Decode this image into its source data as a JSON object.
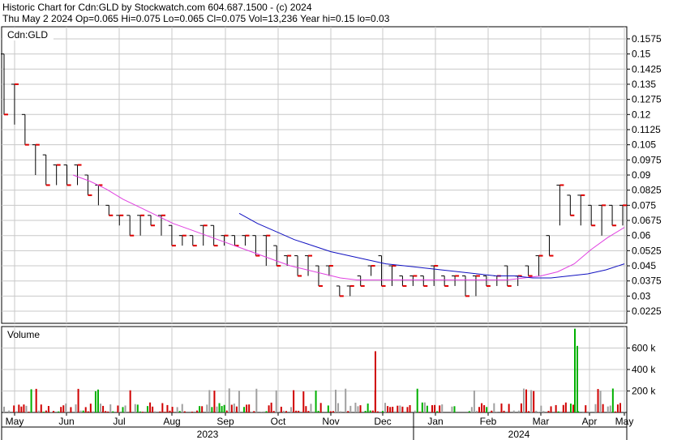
{
  "header": {
    "line1": "Historic Chart for Cdn:GLD by Stockwatch.com 604.687.1500 - (c) 2024",
    "line2": "Thu May  2 2024  Op=0.065  Hi=0.075  Lo=0.065  Cl=0.075  Vol=13,236  Year hi=0.15  lo=0.03"
  },
  "price_panel": {
    "label": "Cdn:GLD"
  },
  "volume_panel": {
    "label": "Volume"
  },
  "colors": {
    "grid": "#c8c8c8",
    "bars": "#000000",
    "close_dash": "#e00000",
    "ma_short": "#e040e0",
    "ma_long": "#1010c0",
    "vol_up": "#00b000",
    "vol_down": "#d00000",
    "vol_flat": "#a0a0a0"
  },
  "chart_data": [
    {
      "type": "line",
      "title": "Historic Chart for Cdn:GLD",
      "x_ticks": [
        "May",
        "Jun",
        "Jul",
        "Aug",
        "Sep",
        "Oct",
        "Nov",
        "Dec",
        "Jan",
        "Feb",
        "Mar",
        "Apr",
        "May"
      ],
      "year_labels": [
        "2023",
        "2024"
      ],
      "y_ticks": [
        "0.1575",
        "0.15",
        "0.1425",
        "0.135",
        "0.1275",
        "0.12",
        "0.1125",
        "0.105",
        "0.0975",
        "0.09",
        "0.0825",
        "0.075",
        "0.0675",
        "0.06",
        "0.0525",
        "0.045",
        "0.0375",
        "0.03",
        "0.0225"
      ],
      "ylim": [
        0.0165,
        0.1635
      ],
      "grid": true,
      "series": [
        {
          "name": "price",
          "points": [
            [
              "May",
              0.15,
              0.12
            ],
            [
              "May",
              0.135,
              0.115
            ],
            [
              "May",
              0.12,
              0.105
            ],
            [
              "May",
              0.105,
              0.09
            ],
            [
              "May",
              0.1,
              0.085
            ],
            [
              "May",
              0.095,
              0.085
            ],
            [
              "May",
              0.095,
              0.085
            ],
            [
              "Jun",
              0.095,
              0.085
            ],
            [
              "Jun",
              0.09,
              0.08
            ],
            [
              "Jun",
              0.085,
              0.075
            ],
            [
              "Jun",
              0.075,
              0.07
            ],
            [
              "Jun",
              0.07,
              0.065
            ],
            [
              "Jun",
              0.07,
              0.06
            ],
            [
              "Jun",
              0.07,
              0.06
            ],
            [
              "Jul",
              0.07,
              0.065
            ],
            [
              "Jul",
              0.07,
              0.06
            ],
            [
              "Jul",
              0.065,
              0.055
            ],
            [
              "Jul",
              0.06,
              0.055
            ],
            [
              "Jul",
              0.06,
              0.055
            ],
            [
              "Aug",
              0.065,
              0.055
            ],
            [
              "Aug",
              0.065,
              0.055
            ],
            [
              "Aug",
              0.06,
              0.055
            ],
            [
              "Aug",
              0.06,
              0.055
            ],
            [
              "Aug",
              0.06,
              0.055
            ],
            [
              "Sep",
              0.06,
              0.05
            ],
            [
              "Sep",
              0.06,
              0.045
            ],
            [
              "Sep",
              0.055,
              0.045
            ],
            [
              "Sep",
              0.05,
              0.045
            ],
            [
              "Oct",
              0.05,
              0.04
            ],
            [
              "Oct",
              0.05,
              0.04
            ],
            [
              "Oct",
              0.045,
              0.035
            ],
            [
              "Oct",
              0.045,
              0.04
            ],
            [
              "Nov",
              0.035,
              0.03
            ],
            [
              "Nov",
              0.035,
              0.03
            ],
            [
              "Nov",
              0.04,
              0.035
            ],
            [
              "Nov",
              0.045,
              0.04
            ],
            [
              "Dec",
              0.05,
              0.035
            ],
            [
              "Dec",
              0.045,
              0.035
            ],
            [
              "Dec",
              0.04,
              0.035
            ],
            [
              "Dec",
              0.04,
              0.035
            ],
            [
              "Jan",
              0.04,
              0.035
            ],
            [
              "Jan",
              0.045,
              0.035
            ],
            [
              "Jan",
              0.04,
              0.035
            ],
            [
              "Jan",
              0.04,
              0.035
            ],
            [
              "Feb",
              0.04,
              0.03
            ],
            [
              "Feb",
              0.04,
              0.03
            ],
            [
              "Feb",
              0.04,
              0.035
            ],
            [
              "Feb",
              0.04,
              0.035
            ],
            [
              "Mar",
              0.045,
              0.035
            ],
            [
              "Mar",
              0.04,
              0.035
            ],
            [
              "Mar",
              0.045,
              0.04
            ],
            [
              "Mar",
              0.05,
              0.04
            ],
            [
              "Mar",
              0.06,
              0.05
            ],
            [
              "Mar",
              0.085,
              0.065
            ],
            [
              "Apr",
              0.08,
              0.07
            ],
            [
              "Apr",
              0.08,
              0.065
            ],
            [
              "Apr",
              0.075,
              0.065
            ],
            [
              "Apr",
              0.075,
              0.06
            ],
            [
              "Apr",
              0.075,
              0.065
            ],
            [
              "May",
              0.075,
              0.065
            ]
          ]
        },
        {
          "name": "ma_short",
          "values": [
            0.09,
            0.087,
            0.083,
            0.078,
            0.074,
            0.07,
            0.066,
            0.063,
            0.06,
            0.057,
            0.054,
            0.051,
            0.048,
            0.045,
            0.043,
            0.041,
            0.039,
            0.038,
            0.038,
            0.038,
            0.038,
            0.038,
            0.038,
            0.038,
            0.038,
            0.038,
            0.038,
            0.039,
            0.04,
            0.042,
            0.046,
            0.053,
            0.059,
            0.064
          ]
        },
        {
          "name": "ma_long",
          "values": [
            0.071,
            0.066,
            0.062,
            0.058,
            0.055,
            0.052,
            0.05,
            0.048,
            0.046,
            0.045,
            0.044,
            0.043,
            0.042,
            0.041,
            0.04,
            0.04,
            0.039,
            0.039,
            0.04,
            0.041,
            0.043,
            0.046
          ]
        }
      ]
    },
    {
      "type": "bar",
      "title": "Volume",
      "y_ticks": [
        "600 k",
        "400 k",
        "200 k"
      ],
      "ylim": [
        0,
        800000
      ],
      "grid": true,
      "notable": [
        {
          "month": "Dec",
          "value": 570000,
          "direction": "down"
        },
        {
          "month": "Mar",
          "value": 780000,
          "direction": "up"
        },
        {
          "month": "Mar",
          "value": 620000,
          "direction": "up"
        }
      ]
    }
  ]
}
